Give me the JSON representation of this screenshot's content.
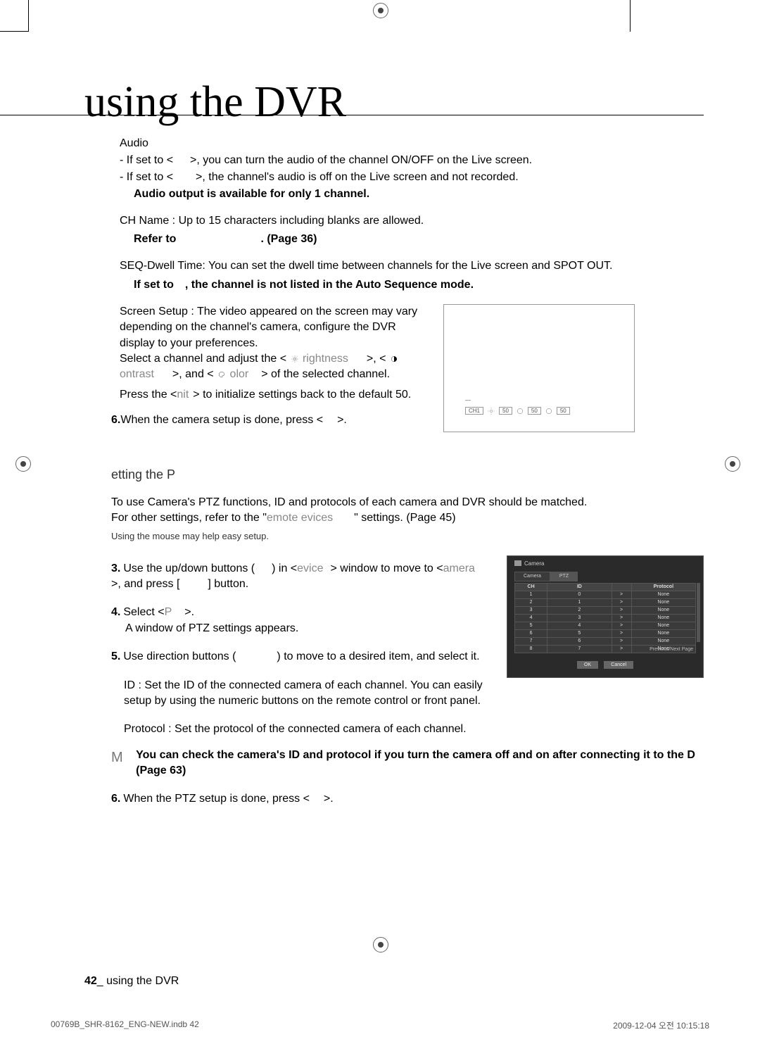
{
  "title": "using the DVR",
  "audio": {
    "head": "Audio",
    "line1a": "- If set to <",
    "line1b": ">, you can turn the audio of the channel ON/OFF on the Live screen.",
    "line2a": "- If set to <",
    "line2b": ">, the channel's audio is off on the Live screen and not recorded.",
    "bold": "Audio output is available for only 1 channel."
  },
  "chname": {
    "line": "CH Name : Up to 15 characters including blanks are allowed.",
    "refer": "Refer to",
    "page": ". (Page 36)"
  },
  "seq": {
    "line": "SEQ-Dwell Time: You can set the dwell time between channels for the Live screen and SPOT OUT.",
    "bold1": "If set to",
    "bold2": ", the channel is not listed in the Auto Sequence mode."
  },
  "screen": {
    "p1": "Screen Setup : The video appeared on the screen may vary depending on the channel's camera, configure the DVR display to your preferences.",
    "p2a": "Select a channel and adjust the <",
    "p2b": "rightness",
    "p2c": ">, <",
    "p2d": "ontrast",
    "p2e": ">, and <",
    "p2f": "olor",
    "p2g": "> of the selected channel.",
    "p3a": "Press the <",
    "p3b": "nit",
    "p3c": "> to initialize settings back to the default 50."
  },
  "step6a": {
    "num": "6.",
    "text": "When the camera setup is done, press <",
    "end": ">."
  },
  "preview": {
    "ch": "CH1",
    "v1": "50",
    "v2": "50",
    "v3": "50"
  },
  "ptz": {
    "head": "etting the P",
    "intro1": "To use Camera's PTZ functions, ID and protocols of each camera and DVR should be matched.",
    "intro2a": "For other settings, refer to the \"",
    "intro2b": "emote evices",
    "intro2c": "\" settings. (Page 45)",
    "mouse": "Using the mouse may help easy setup."
  },
  "step3": {
    "num": "3.",
    "a": "Use the up/down buttons (",
    "b": ") in <",
    "c": "evice",
    "d": "> window to move to <",
    "e": "amera",
    "f": ">, and press [",
    "g": "] button."
  },
  "step4": {
    "num": "4.",
    "a": "Select <",
    "b": "P",
    "c": ">.",
    "d": "A window of PTZ settings appears."
  },
  "step5": {
    "num": "5.",
    "a": "Use direction buttons (",
    "b": ") to move to a desired item, and select it."
  },
  "idline": "ID : Set the ID of the connected camera of each channel. You can easily setup by using the numeric buttons on the remote control or front panel.",
  "protoline": "Protocol : Set the protocol of the connected camera of each channel.",
  "note": {
    "text": "You can check the camera's ID and protocol if you turn the camera off and on after connecting it to the D",
    "page": "(Page 63)"
  },
  "step6b": {
    "num": "6.",
    "a": "When the PTZ setup is done, press <",
    "b": ">."
  },
  "dvr": {
    "title": "Camera",
    "tab1": "Camera",
    "tab2": "PTZ",
    "headers": [
      "CH",
      "ID",
      "",
      "Protocol"
    ],
    "rows": [
      [
        "1",
        "0",
        ">",
        "None"
      ],
      [
        "2",
        "1",
        ">",
        "None"
      ],
      [
        "3",
        "2",
        ">",
        "None"
      ],
      [
        "4",
        "3",
        ">",
        "None"
      ],
      [
        "5",
        "4",
        ">",
        "None"
      ],
      [
        "6",
        "5",
        ">",
        "None"
      ],
      [
        "7",
        "6",
        ">",
        "None"
      ],
      [
        "8",
        "7",
        ">",
        "None"
      ]
    ],
    "pager": "Previous/Next Page",
    "ok": "OK",
    "cancel": "Cancel"
  },
  "footer": {
    "num": "42",
    "text": "_ using the DVR"
  },
  "scan": {
    "file": "00769B_SHR-8162_ENG-NEW.indb   42",
    "date": "2009-12-04   오전 10:15:18"
  }
}
